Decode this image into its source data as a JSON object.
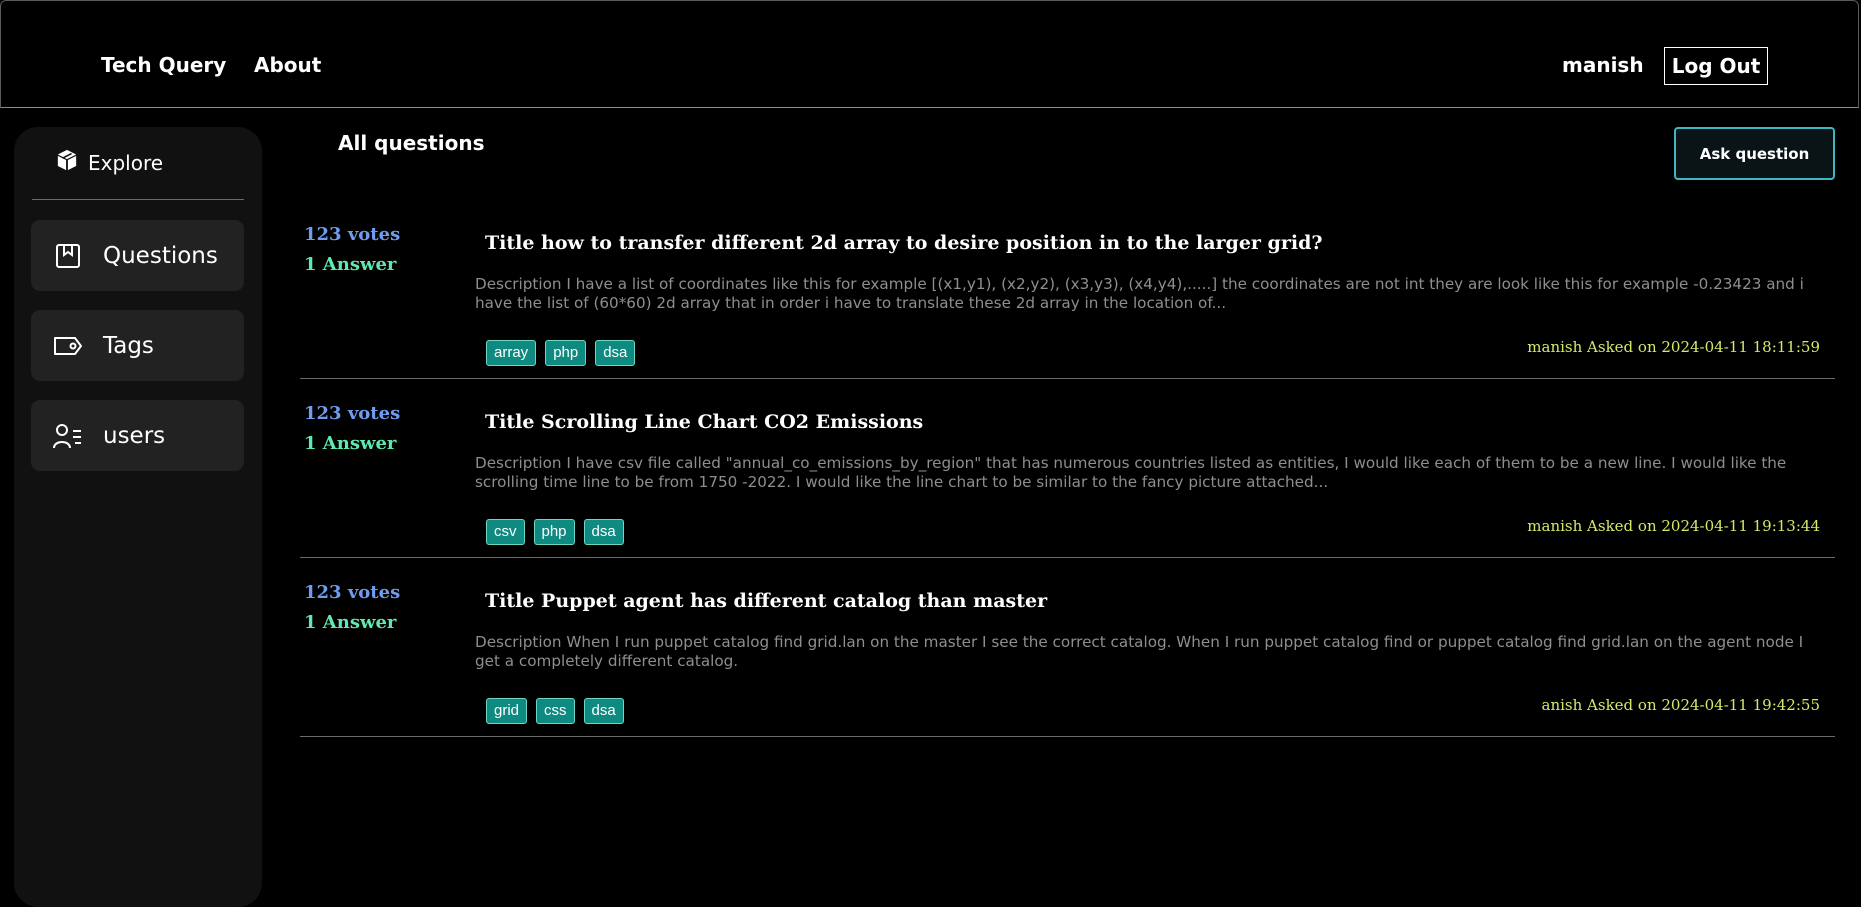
{
  "colors": {
    "accent": "#3cb8c4",
    "votes": "#6f9cf0",
    "answers": "#5fe8b0",
    "meta": "#d4e86a",
    "tag_bg": "#0f8a80"
  },
  "navbar": {
    "brand": "Tech Query",
    "about": "About",
    "username": "manish",
    "logout": "Log Out"
  },
  "sidebar": {
    "explore": {
      "label": "Explore",
      "icon": "cube-icon"
    },
    "items": [
      {
        "label": "Questions",
        "icon": "bookmark-icon"
      },
      {
        "label": "Tags",
        "icon": "tag-icon"
      },
      {
        "label": "users",
        "icon": "users-list-icon"
      }
    ]
  },
  "main": {
    "title": "All questions",
    "ask_button": "Ask question"
  },
  "questions": [
    {
      "votes": "123 votes",
      "answers": "1 Answer",
      "title": "Title how to transfer different 2d array to desire position in to the larger grid?",
      "description": "Description I have a list of coordinates like this for example [(x1,y1), (x2,y2), (x3,y3), (x4,y4),.....] the coordinates are not int they are look like this for example -0.23423 and i have the list of (60*60) 2d array that in order i have to translate these 2d array in the location of...",
      "tags": [
        "array",
        "php",
        "dsa"
      ],
      "meta": "manish Asked on 2024-04-11 18:11:59"
    },
    {
      "votes": "123 votes",
      "answers": "1 Answer",
      "title": "Title Scrolling Line Chart CO2 Emissions",
      "description": "Description I have csv file called \"annual_co_emissions_by_region\" that has numerous countries listed as entities, I would like each of them to be a new line. I would like the scrolling time line to be from 1750 -2022. I would like the line chart to be similar to the fancy picture attached...",
      "tags": [
        "csv",
        "php",
        "dsa"
      ],
      "meta": "manish Asked on 2024-04-11 19:13:44"
    },
    {
      "votes": "123 votes",
      "answers": "1 Answer",
      "title": "Title Puppet agent has different catalog than master",
      "description": "Description When I run puppet catalog find grid.lan on the master I see the correct catalog. When I run puppet catalog find or puppet catalog find grid.lan on the agent node I get a completely different catalog.",
      "tags": [
        "grid",
        "css",
        "dsa"
      ],
      "meta": "anish Asked on 2024-04-11 19:42:55"
    }
  ]
}
